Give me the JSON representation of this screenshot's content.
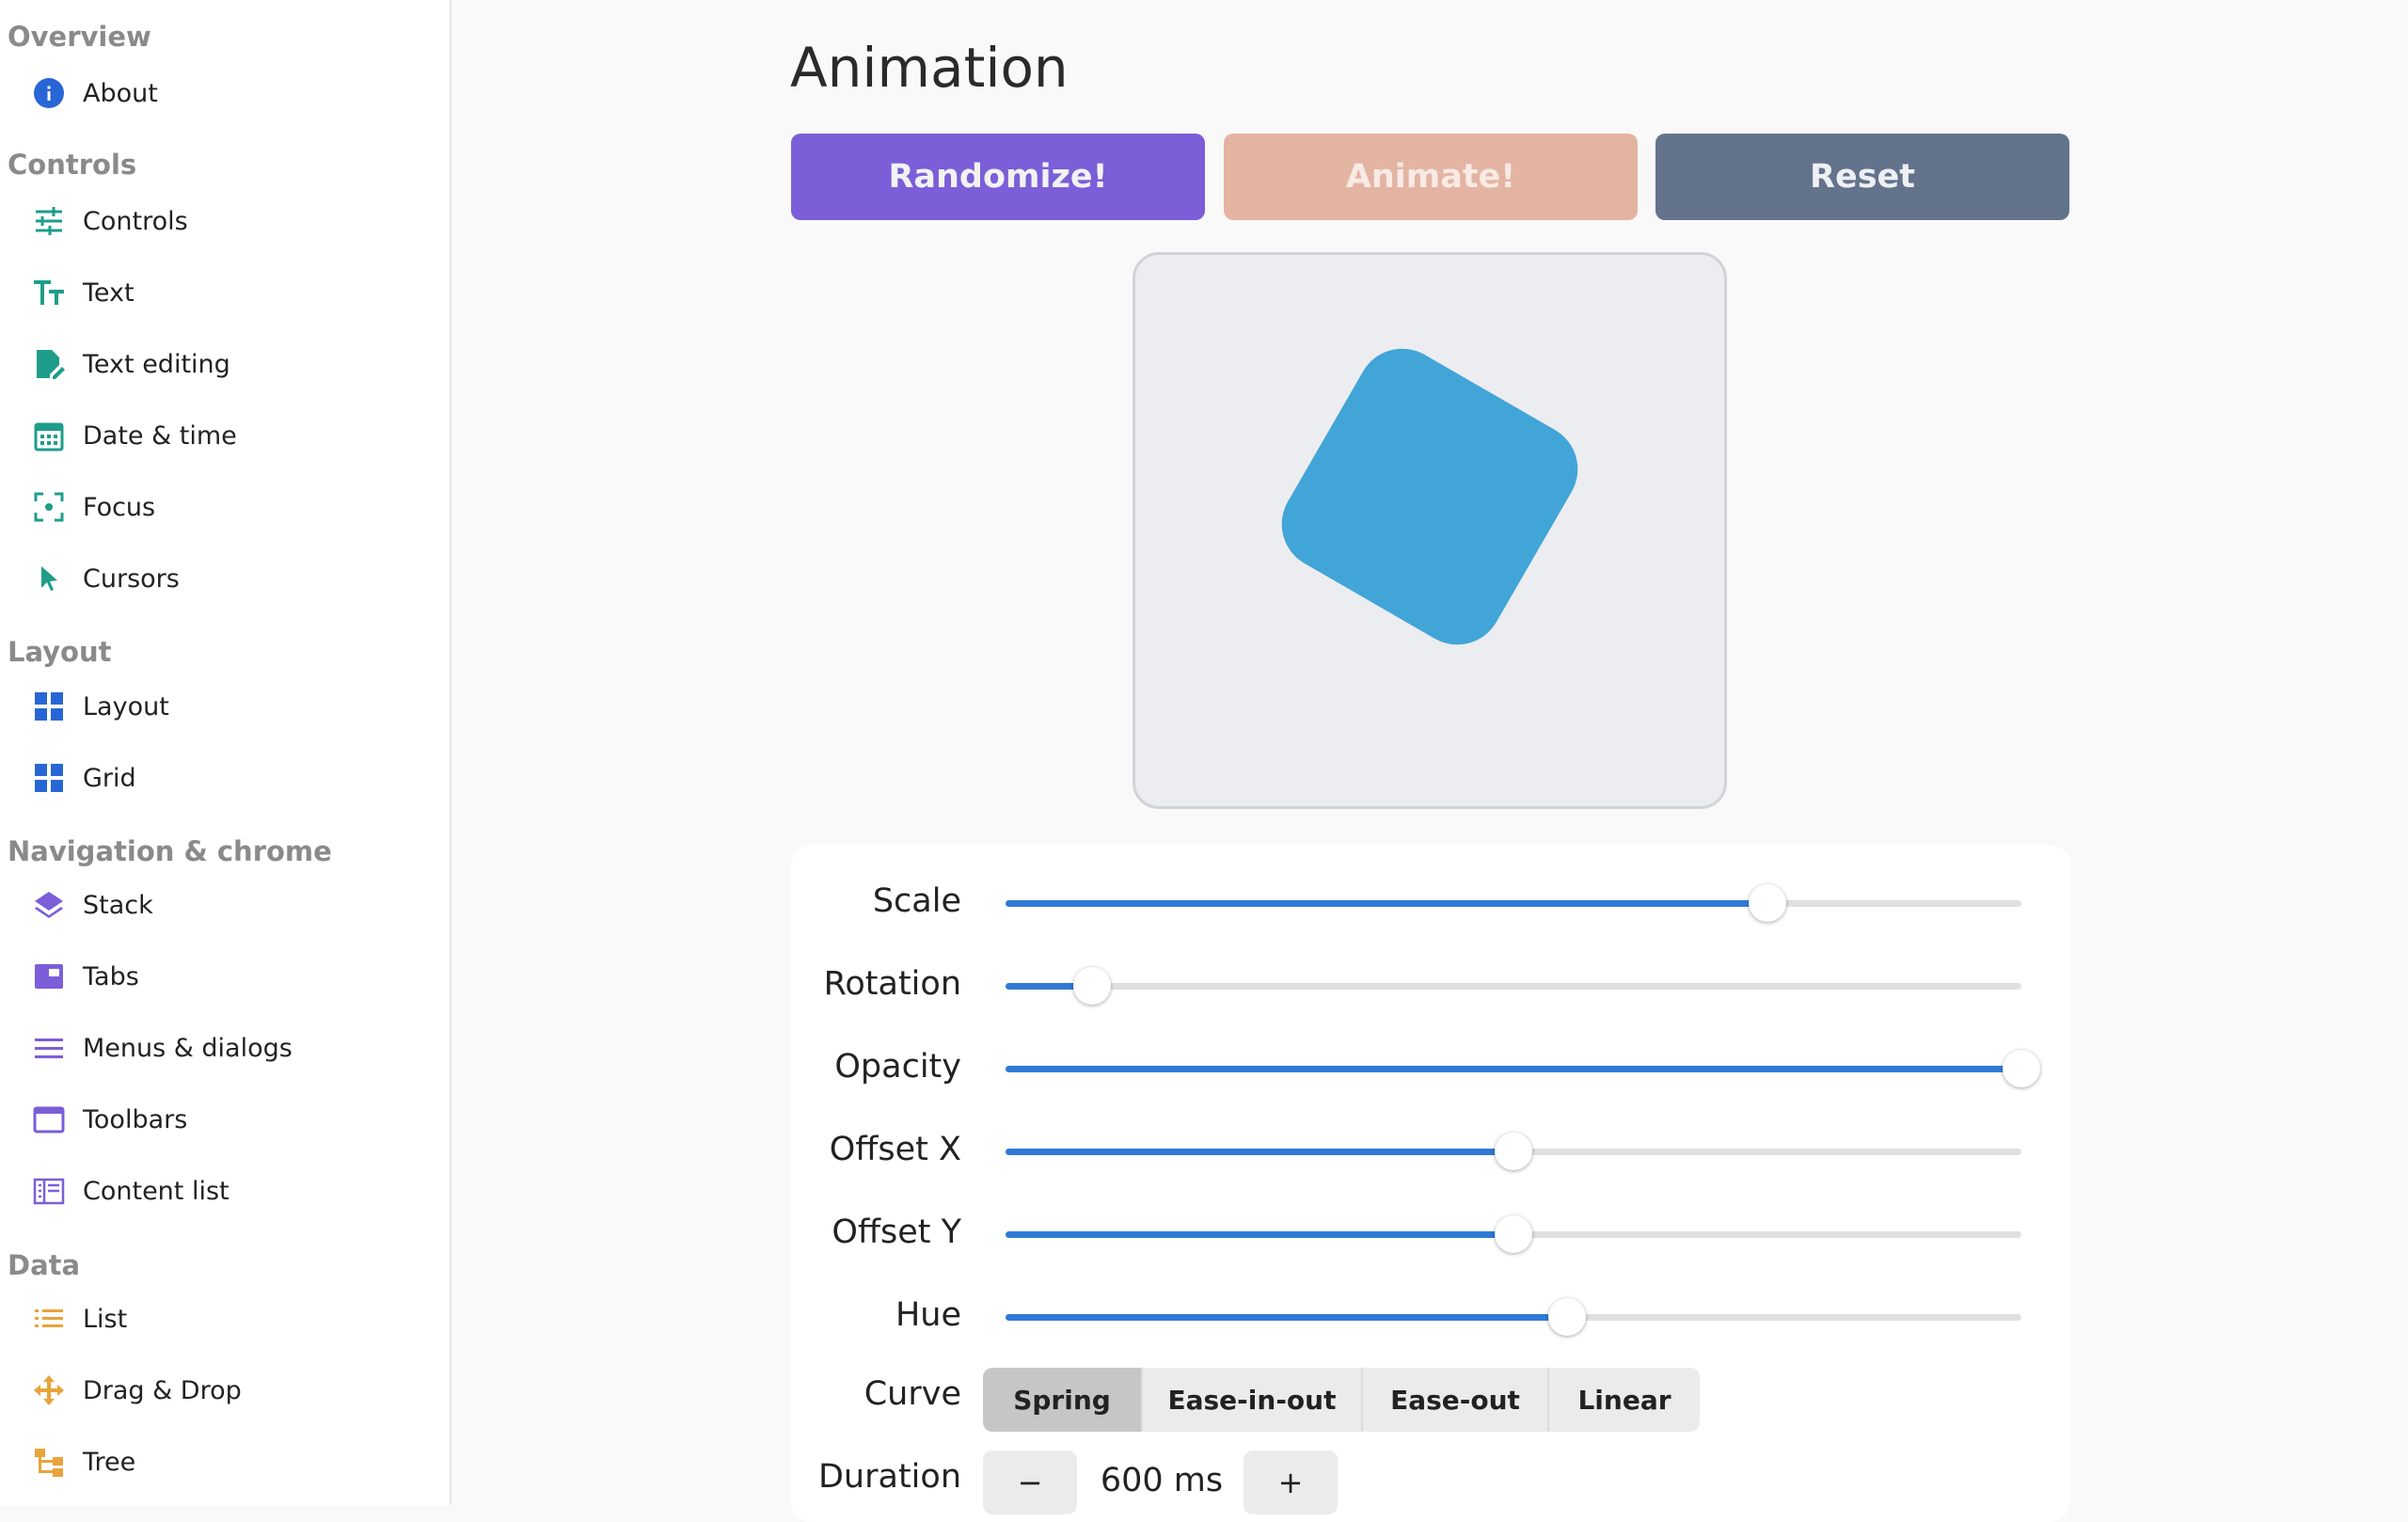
{
  "sidebar": {
    "sections": {
      "overview": "Overview",
      "controls": "Controls",
      "layout": "Layout",
      "navigation": "Navigation & chrome",
      "data": "Data"
    },
    "items": {
      "about": "About",
      "controls": "Controls",
      "text": "Text",
      "text_editing": "Text editing",
      "date_time": "Date & time",
      "focus": "Focus",
      "cursors": "Cursors",
      "layout": "Layout",
      "grid": "Grid",
      "stack": "Stack",
      "tabs": "Tabs",
      "menus_dialogs": "Menus & dialogs",
      "toolbars": "Toolbars",
      "content_list": "Content list",
      "list": "List",
      "drag_drop": "Drag & Drop",
      "tree": "Tree"
    }
  },
  "main": {
    "title": "Animation",
    "buttons": {
      "randomize": "Randomize!",
      "animate": "Animate!",
      "reset": "Reset"
    },
    "sliders": [
      {
        "label": "Scale",
        "fraction": 0.75
      },
      {
        "label": "Rotation",
        "fraction": 0.085
      },
      {
        "label": "Opacity",
        "fraction": 1.0
      },
      {
        "label": "Offset X",
        "fraction": 0.5
      },
      {
        "label": "Offset Y",
        "fraction": 0.5
      },
      {
        "label": "Hue",
        "fraction": 0.553
      }
    ],
    "curve": {
      "label": "Curve",
      "options": [
        "Spring",
        "Ease-in-out",
        "Ease-out",
        "Linear"
      ],
      "selected": "Spring"
    },
    "duration": {
      "label": "Duration",
      "value": "600 ms",
      "decrement": "−",
      "increment": "+"
    }
  },
  "colors": {
    "accent": "#2f7ad6",
    "randomize": "#7b5ed8",
    "animate": "#e4b4a3",
    "reset": "#63738c",
    "shape": "#42a5d8"
  },
  "icons": {
    "about": "info-icon",
    "controls": "sliders-icon",
    "text": "text-size-icon",
    "text_editing": "edit-document-icon",
    "date_time": "calendar-icon",
    "focus": "focus-icon",
    "cursors": "cursor-icon",
    "layout": "grid-icon",
    "stack": "layers-icon",
    "tabs": "tabs-icon",
    "menus_dialogs": "menu-icon",
    "toolbars": "window-icon",
    "content_list": "content-list-icon",
    "list": "list-icon",
    "drag_drop": "move-icon",
    "tree": "tree-icon"
  }
}
